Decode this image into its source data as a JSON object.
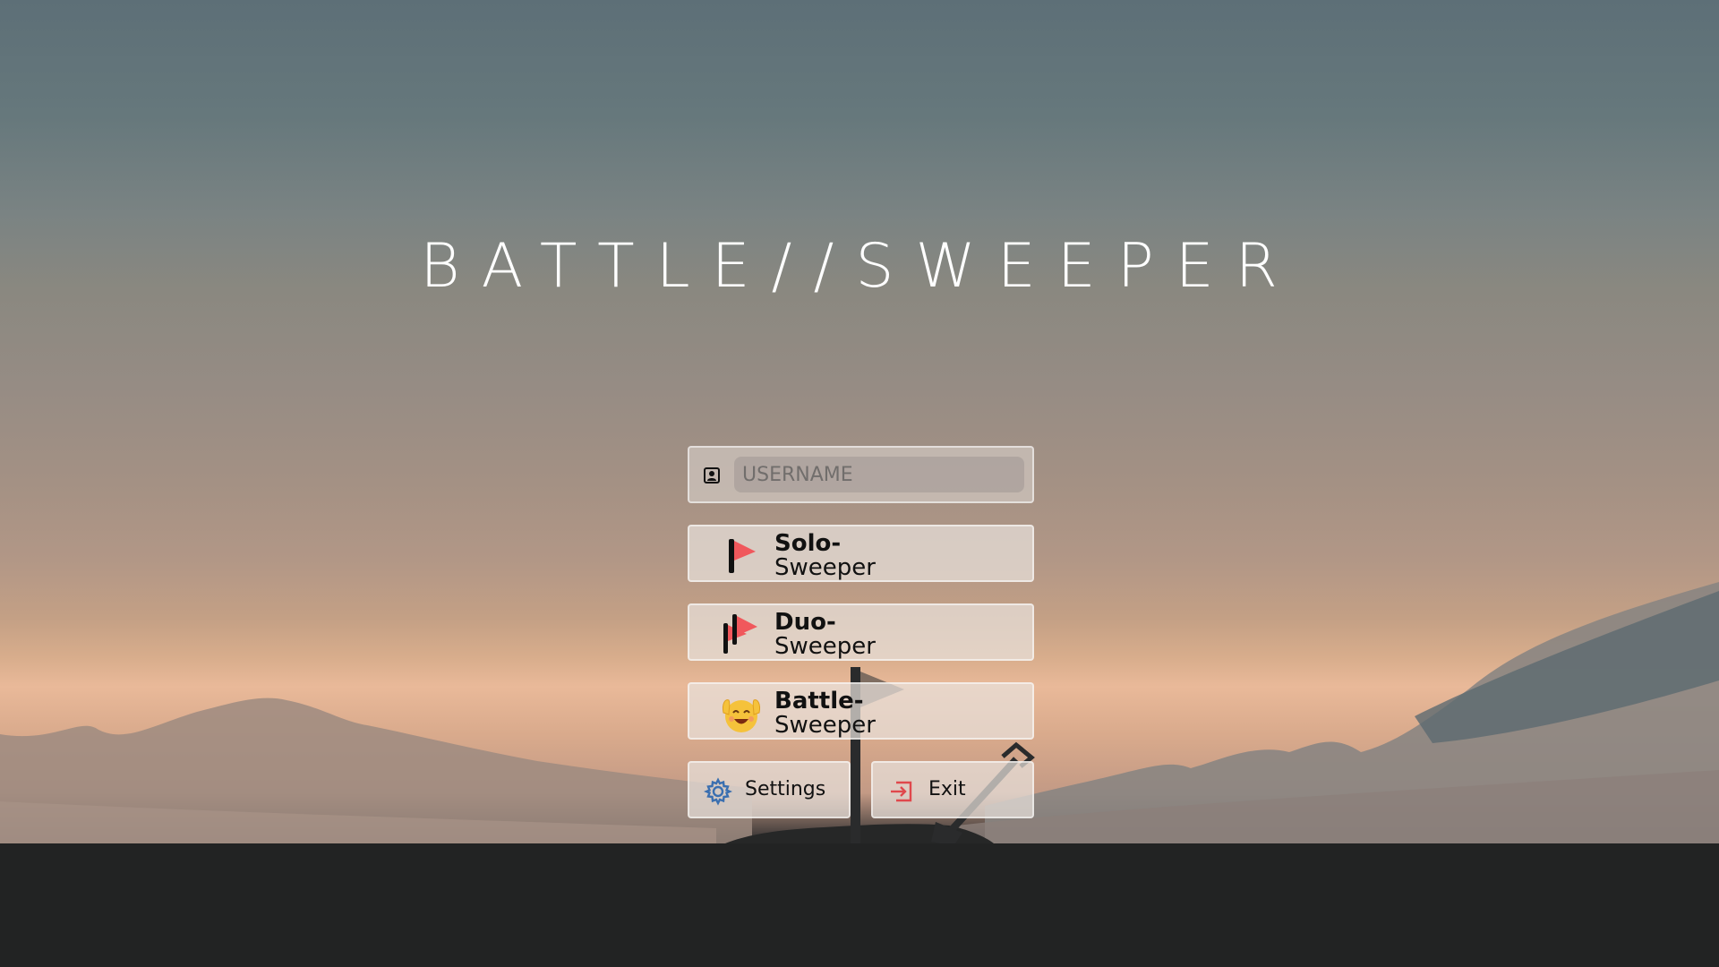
{
  "title": "BATTLE//SWEEPER",
  "username": {
    "placeholder": "USERNAME",
    "value": ""
  },
  "modes": [
    {
      "line1": "Solo-",
      "line2": "Sweeper",
      "icon": "flag-icon"
    },
    {
      "line1": "Duo-",
      "line2": "Sweeper",
      "icon": "double-flag-icon"
    },
    {
      "line1": "Battle-",
      "line2": "Sweeper",
      "icon": "celebrating-face-icon"
    }
  ],
  "settings_label": "Settings",
  "exit_label": "Exit",
  "colors": {
    "flag": "#f0585c",
    "settings_icon": "#3a6fb0",
    "exit_icon": "#e0484c",
    "ground": "#222323"
  }
}
